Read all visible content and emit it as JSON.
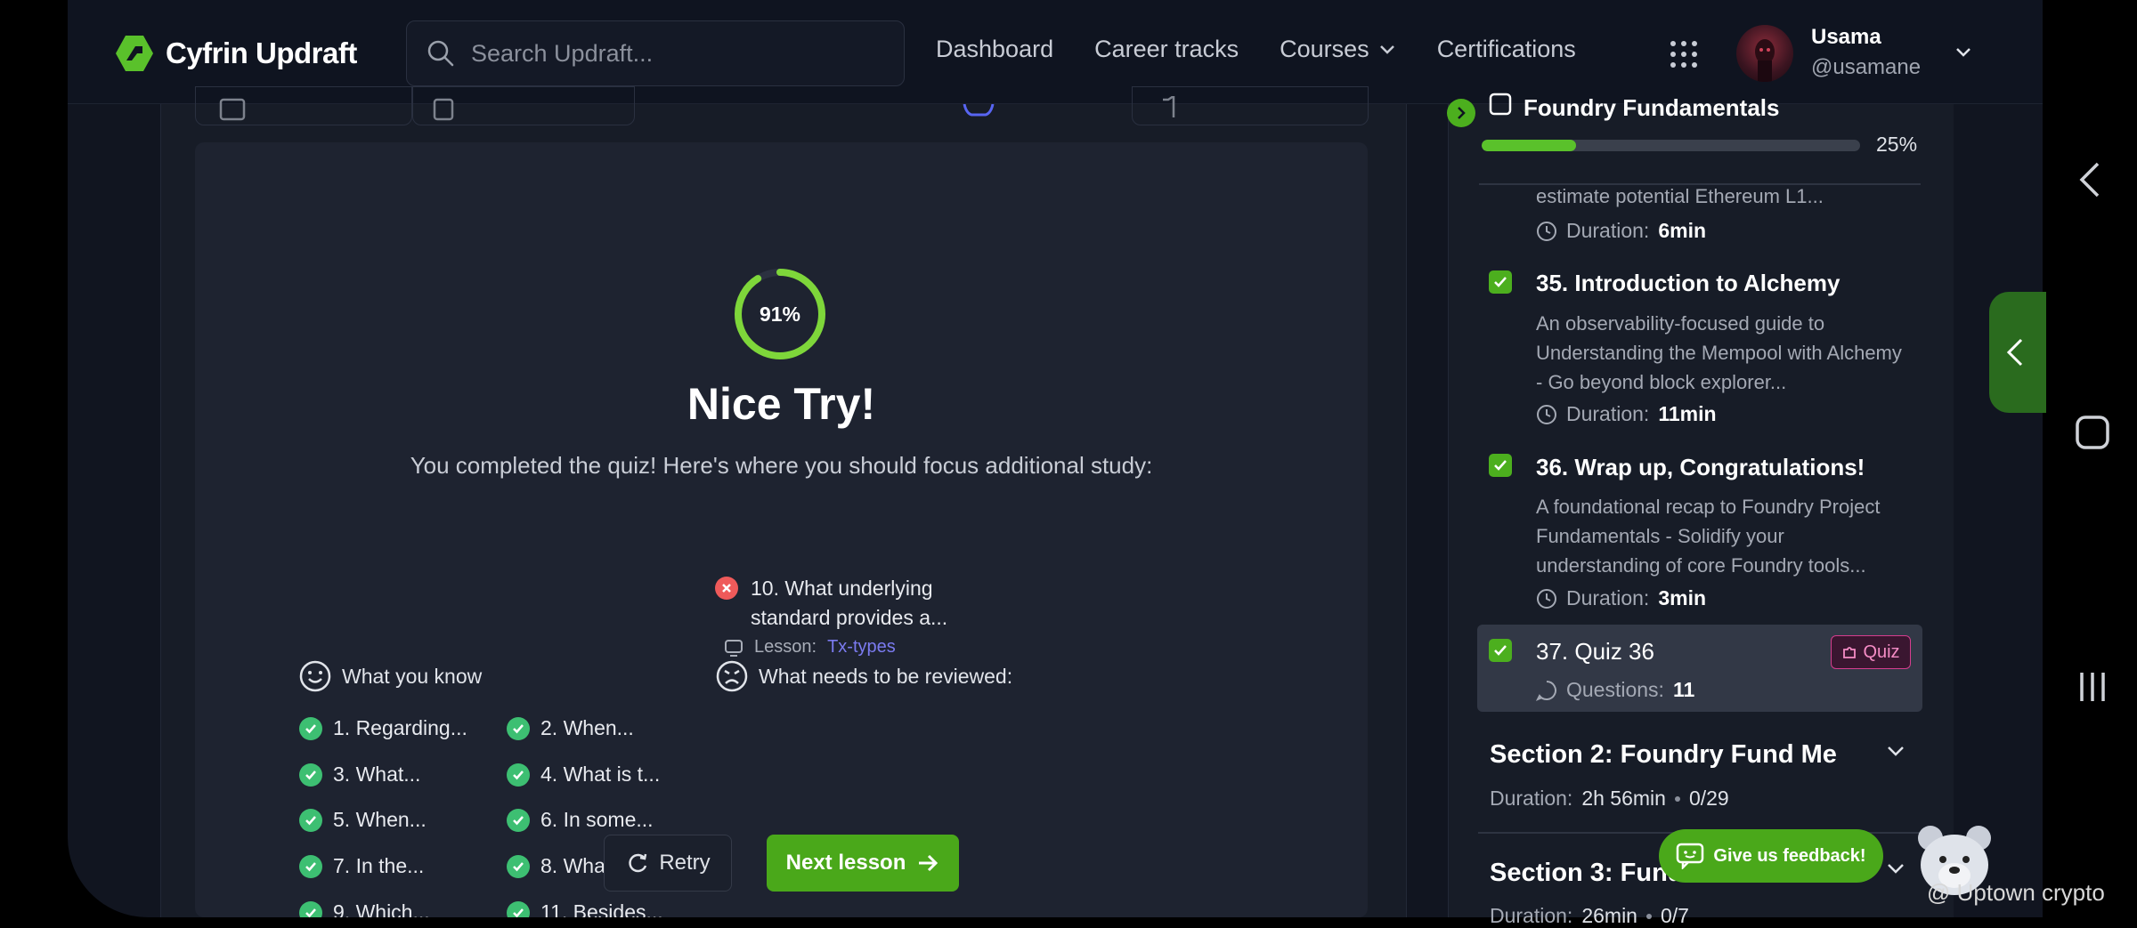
{
  "app": {
    "logo_text": "Cyfrin Updraft"
  },
  "search": {
    "placeholder": "Search Updraft..."
  },
  "nav": {
    "dashboard": "Dashboard",
    "career_tracks": "Career tracks",
    "courses": "Courses",
    "certifications": "Certifications"
  },
  "user": {
    "name": "Usama",
    "handle": "@usamane"
  },
  "quiz": {
    "score_label": "91%",
    "score_fraction": 0.91,
    "title": "Nice Try!",
    "subtitle": "You completed the quiz! Here's where you should focus additional study:",
    "know_heading": "What you know",
    "review_heading": "What needs to be reviewed:",
    "known_items": [
      "1. Regarding...",
      "2. When...",
      "3. What...",
      "4. What is t...",
      "5. When...",
      "6. In some...",
      "7. In the...",
      "8. What...",
      "9. Which...",
      "11. Besides..."
    ],
    "review_item": "10. What underlying standard provides a...",
    "lesson_prefix": "Lesson:",
    "lesson_link": "Tx-types",
    "retry_label": "Retry",
    "next_label": "Next lesson"
  },
  "sidebar": {
    "course_title": "Foundry Fundamentals",
    "progress_label": "25%",
    "progress_fraction": 0.25,
    "lesson_prev_desc": "estimate potential Ethereum L1...",
    "lesson_prev_duration": "6min",
    "duration_label": "Duration:",
    "lessons": [
      {
        "title": "35. Introduction to Alchemy",
        "desc": "An observability-focused guide to Understanding the Mempool with Alchemy - Go beyond block explorer...",
        "duration": "11min"
      },
      {
        "title": "36. Wrap up, Congratulations!",
        "desc": "A foundational recap to Foundry Project Fundamentals - Solidify your understanding of core Foundry tools...",
        "duration": "3min"
      }
    ],
    "active_lesson": {
      "title": "37. Quiz 36",
      "badge": "Quiz",
      "questions_label": "Questions:",
      "questions": "11"
    },
    "sections": [
      {
        "title": "Section 2: Foundry Fund Me",
        "duration": "2h 56min",
        "count": "0/29"
      },
      {
        "title": "Section 3: Fund",
        "duration": "26min",
        "count": "0/7"
      }
    ]
  },
  "feedback": {
    "label": "Give us feedback!"
  },
  "watermark": {
    "text": "@ Uptown crypto"
  },
  "colors": {
    "accent": "#4aa81a",
    "ring": "#7ed63a",
    "error": "#ef5a5a",
    "success": "#3dbf72",
    "quiz_badge": "#d63d8e",
    "link": "#7b7bf0"
  }
}
